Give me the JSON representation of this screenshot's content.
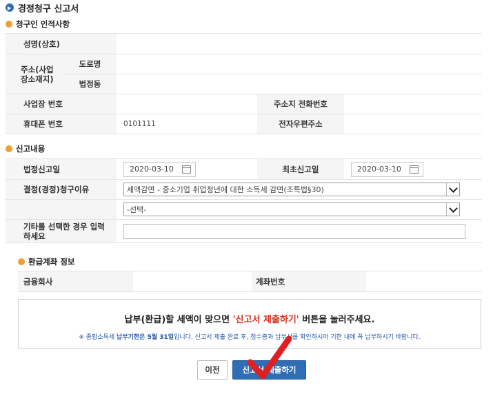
{
  "page_title": "경정청구 신고서",
  "section_applicant": "청구인 인적사항",
  "applicant": {
    "name_label": "성명(상호)",
    "name_value": "",
    "address_label": "주소(사업장소재지)",
    "road_label": "도로명",
    "road_value": "",
    "lot_label": "법정동",
    "lot_value": "",
    "biz_no_label": "사업장 번호",
    "biz_no_value": "",
    "addr_phone_label": "주소지 전화번호",
    "addr_phone_value": "",
    "mobile_label": "휴대폰 번호",
    "mobile_value": "0101111",
    "email_label": "전자우편주소",
    "email_value": ""
  },
  "section_report": "신고내용",
  "report": {
    "legal_date_label": "법정신고일",
    "legal_date_value": "2020-03-10",
    "first_date_label": "최초신고일",
    "first_date_value": "2020-03-10",
    "reason_label": "결정(경정)청구이유",
    "reason_value": "세액감면 - 중소기업 취업청년에 대한 소득세 감면(조특법§30)",
    "reason2_value": "-선택-",
    "other_label": "기타를 선택한 경우 입력하세요",
    "other_value": ""
  },
  "section_refund": "환급계좌 정보",
  "refund": {
    "bank_label": "금융회사",
    "bank_value": "",
    "account_label": "계좌번호",
    "account_value": ""
  },
  "notice": {
    "line1_pre": "납부(환급)할 세액이 맞으면 ",
    "line1_red": "'신고서 제출하기'",
    "line1_post": " 버튼을 눌러주세요.",
    "line2_pre": "※ 종합소득세 ",
    "line2_bold": "납부기한은 5월 31일",
    "line2_post": "입니다. 신고서 제출 완료 후, 접수증과 납부서를 확인하시어 기한 내에 꼭 납부하시기 바랍니다."
  },
  "buttons": {
    "prev": "이전",
    "submit": "신고서 제출하기"
  },
  "colors": {
    "accent_blue": "#2f6db5",
    "section_orange": "#f0a030",
    "highlight_red": "#d43020",
    "checkmark_red": "#e02020"
  },
  "icons": [
    "calendar-icon",
    "chevron-down-icon",
    "checkmark-annotation"
  ]
}
